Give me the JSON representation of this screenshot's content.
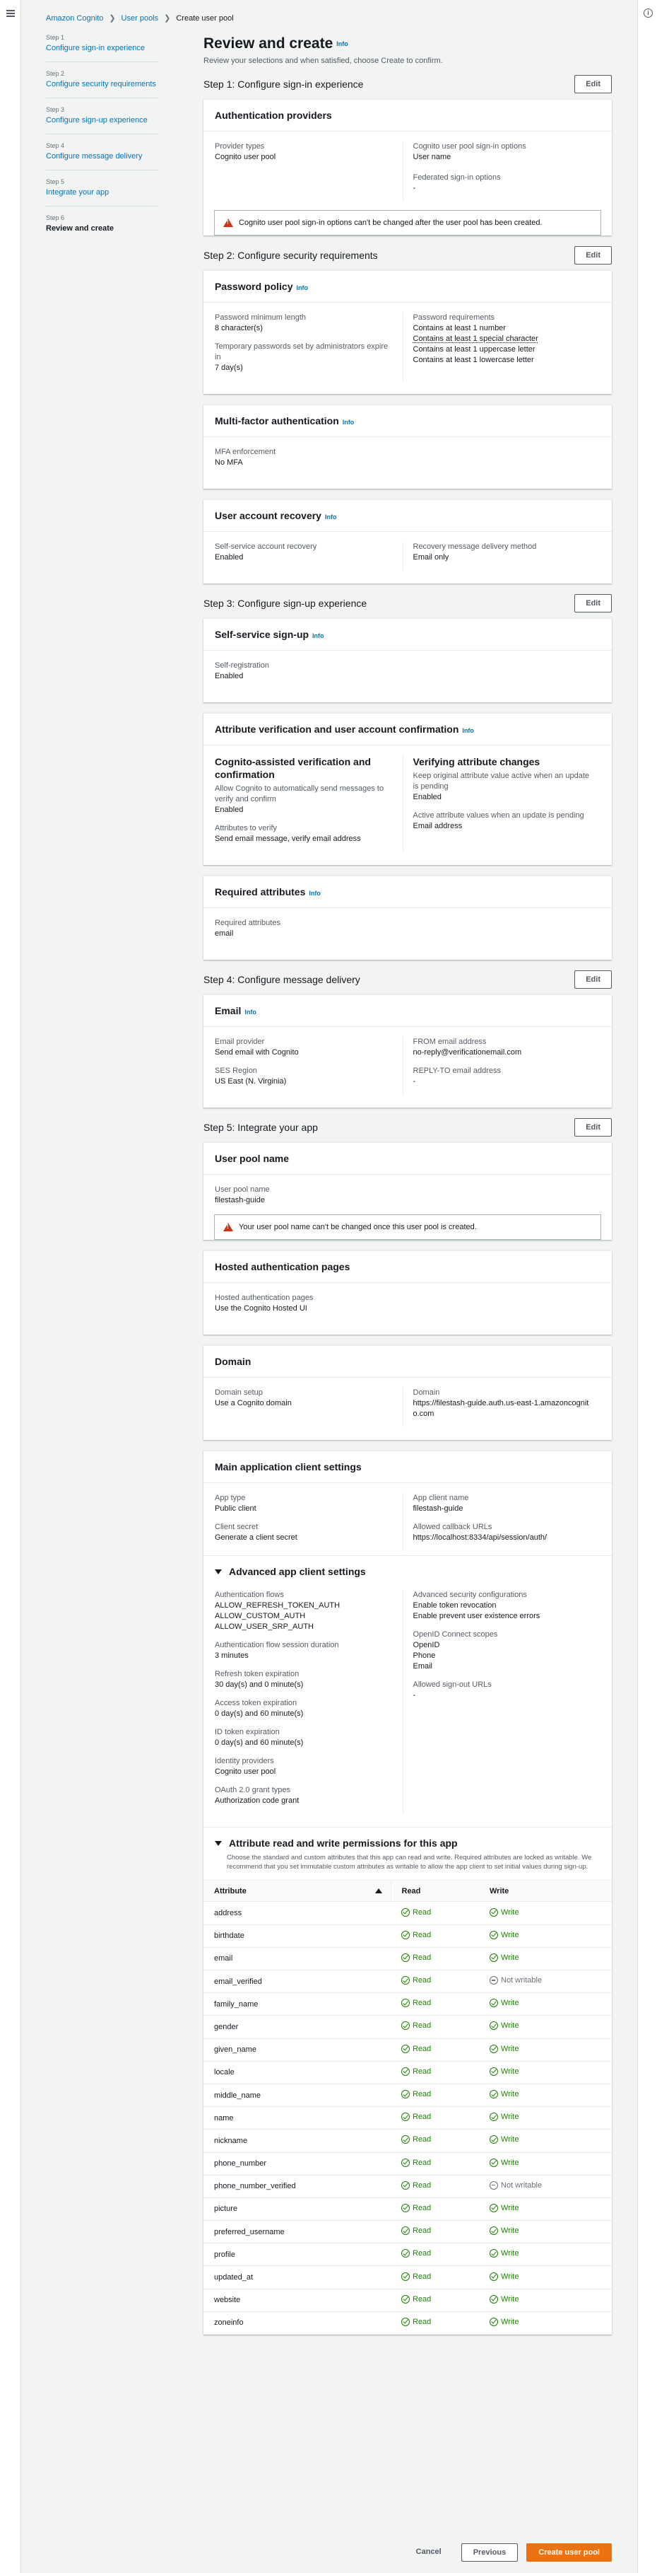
{
  "breadcrumb": [
    "Amazon Cognito",
    "User pools",
    "Create user pool"
  ],
  "steps": [
    {
      "num": "Step 1",
      "label": "Configure sign-in experience"
    },
    {
      "num": "Step 2",
      "label": "Configure security requirements"
    },
    {
      "num": "Step 3",
      "label": "Configure sign-up experience"
    },
    {
      "num": "Step 4",
      "label": "Configure message delivery"
    },
    {
      "num": "Step 5",
      "label": "Integrate your app"
    },
    {
      "num": "Step 6",
      "label": "Review and create"
    }
  ],
  "page": {
    "title": "Review and create",
    "info": "Info",
    "subtitle": "Review your selections and when satisfied, choose Create to confirm.",
    "edit": "Edit"
  },
  "step1": {
    "title": "Step 1: Configure sign-in experience",
    "card": "Authentication providers",
    "provider_types_label": "Provider types",
    "provider_types": "Cognito user pool",
    "signin_label": "Cognito user pool sign-in options",
    "signin": "User name",
    "federated_label": "Federated sign-in options",
    "federated": "-",
    "alert": "Cognito user pool sign-in options can't be changed after the user pool has been created."
  },
  "step2": {
    "title": "Step 2: Configure security requirements",
    "pw": {
      "card": "Password policy",
      "min_label": "Password minimum length",
      "min": "8 character(s)",
      "temp_label": "Temporary passwords set by administrators expire in",
      "temp": "7 day(s)",
      "req_label": "Password requirements",
      "req": [
        "Contains at least 1 number",
        "Contains at least 1 special character",
        "Contains at least 1 uppercase letter",
        "Contains at least 1 lowercase letter"
      ]
    },
    "mfa": {
      "card": "Multi-factor authentication",
      "label": "MFA enforcement",
      "value": "No MFA"
    },
    "rec": {
      "card": "User account recovery",
      "self_label": "Self-service account recovery",
      "self": "Enabled",
      "method_label": "Recovery message delivery method",
      "method": "Email only"
    }
  },
  "step3": {
    "title": "Step 3: Configure sign-up experience",
    "ss": {
      "card": "Self-service sign-up",
      "label": "Self-registration",
      "value": "Enabled"
    },
    "av": {
      "card": "Attribute verification and user account confirmation",
      "left_title": "Cognito-assisted verification and confirmation",
      "left_desc": "Allow Cognito to automatically send messages to verify and confirm",
      "left_val": "Enabled",
      "verify_label": "Attributes to verify",
      "verify": "Send email message, verify email address",
      "right_title": "Verifying attribute changes",
      "keep_label": "Keep original attribute value active when an update is pending",
      "keep": "Enabled",
      "active_label": "Active attribute values when an update is pending",
      "active": "Email address"
    },
    "ra": {
      "card": "Required attributes",
      "label": "Required attributes",
      "value": "email"
    }
  },
  "step4": {
    "title": "Step 4: Configure message delivery",
    "card": "Email",
    "prov_label": "Email provider",
    "prov": "Send email with Cognito",
    "ses_label": "SES Region",
    "ses": "US East (N. Virginia)",
    "from_label": "FROM email address",
    "from": "no-reply@verificationemail.com",
    "reply_label": "REPLY-TO email address",
    "reply": "-"
  },
  "step5": {
    "title": "Step 5: Integrate your app",
    "upn": {
      "card": "User pool name",
      "label": "User pool name",
      "value": "filestash-guide",
      "alert": "Your user pool name can't be changed once this user pool is created."
    },
    "hosted": {
      "card": "Hosted authentication pages",
      "label": "Hosted authentication pages",
      "value": "Use the Cognito Hosted UI"
    },
    "domain": {
      "card": "Domain",
      "setup_label": "Domain setup",
      "setup": "Use a Cognito domain",
      "dom_label": "Domain",
      "dom": "https://filestash-guide.auth.us-east-1.amazoncognito.com"
    },
    "client": {
      "card": "Main application client settings",
      "type_label": "App type",
      "type": "Public client",
      "secret_label": "Client secret",
      "secret": "Generate a client secret",
      "name_label": "App client name",
      "name": "filestash-guide",
      "cb_label": "Allowed callback URLs",
      "cb": "https://localhost:8334/api/session/auth/"
    },
    "adv": {
      "title": "Advanced app client settings",
      "flows_label": "Authentication flows",
      "flows": [
        "ALLOW_REFRESH_TOKEN_AUTH",
        "ALLOW_CUSTOM_AUTH",
        "ALLOW_USER_SRP_AUTH"
      ],
      "dur_label": "Authentication flow session duration",
      "dur": "3 minutes",
      "rt_label": "Refresh token expiration",
      "rt": "30 day(s) and 0 minute(s)",
      "at_label": "Access token expiration",
      "at": "0 day(s) and 60 minute(s)",
      "it_label": "ID token expiration",
      "it": "0 day(s) and 60 minute(s)",
      "ip_label": "Identity providers",
      "ip": "Cognito user pool",
      "oa_label": "OAuth 2.0 grant types",
      "oa": "Authorization code grant",
      "sec_label": "Advanced security configurations",
      "sec": [
        "Enable token revocation",
        "Enable prevent user existence errors"
      ],
      "oidc_label": "OpenID Connect scopes",
      "oidc": [
        "OpenID",
        "Phone",
        "Email"
      ],
      "so_label": "Allowed sign-out URLs",
      "so": "-"
    },
    "perm": {
      "title": "Attribute read and write permissions for this app",
      "desc": "Choose the standard and custom attributes that this app can read and write. Required attributes are locked as writable. We recommend that you set immutable custom attributes as writable to allow the app client to set initial values during sign-up.",
      "col_attr": "Attribute",
      "col_read": "Read",
      "col_write": "Write"
    }
  },
  "attributes": [
    {
      "name": "address",
      "read": "Read",
      "write": "Write",
      "w": true
    },
    {
      "name": "birthdate",
      "read": "Read",
      "write": "Write",
      "w": true
    },
    {
      "name": "email",
      "read": "Read",
      "write": "Write",
      "w": true
    },
    {
      "name": "email_verified",
      "read": "Read",
      "write": "Not writable",
      "w": false
    },
    {
      "name": "family_name",
      "read": "Read",
      "write": "Write",
      "w": true
    },
    {
      "name": "gender",
      "read": "Read",
      "write": "Write",
      "w": true
    },
    {
      "name": "given_name",
      "read": "Read",
      "write": "Write",
      "w": true
    },
    {
      "name": "locale",
      "read": "Read",
      "write": "Write",
      "w": true
    },
    {
      "name": "middle_name",
      "read": "Read",
      "write": "Write",
      "w": true
    },
    {
      "name": "name",
      "read": "Read",
      "write": "Write",
      "w": true
    },
    {
      "name": "nickname",
      "read": "Read",
      "write": "Write",
      "w": true
    },
    {
      "name": "phone_number",
      "read": "Read",
      "write": "Write",
      "w": true
    },
    {
      "name": "phone_number_verified",
      "read": "Read",
      "write": "Not writable",
      "w": false
    },
    {
      "name": "picture",
      "read": "Read",
      "write": "Write",
      "w": true
    },
    {
      "name": "preferred_username",
      "read": "Read",
      "write": "Write",
      "w": true
    },
    {
      "name": "profile",
      "read": "Read",
      "write": "Write",
      "w": true
    },
    {
      "name": "updated_at",
      "read": "Read",
      "write": "Write",
      "w": true
    },
    {
      "name": "website",
      "read": "Read",
      "write": "Write",
      "w": true
    },
    {
      "name": "zoneinfo",
      "read": "Read",
      "write": "Write",
      "w": true
    }
  ],
  "footer": {
    "cancel": "Cancel",
    "previous": "Previous",
    "create": "Create user pool"
  }
}
